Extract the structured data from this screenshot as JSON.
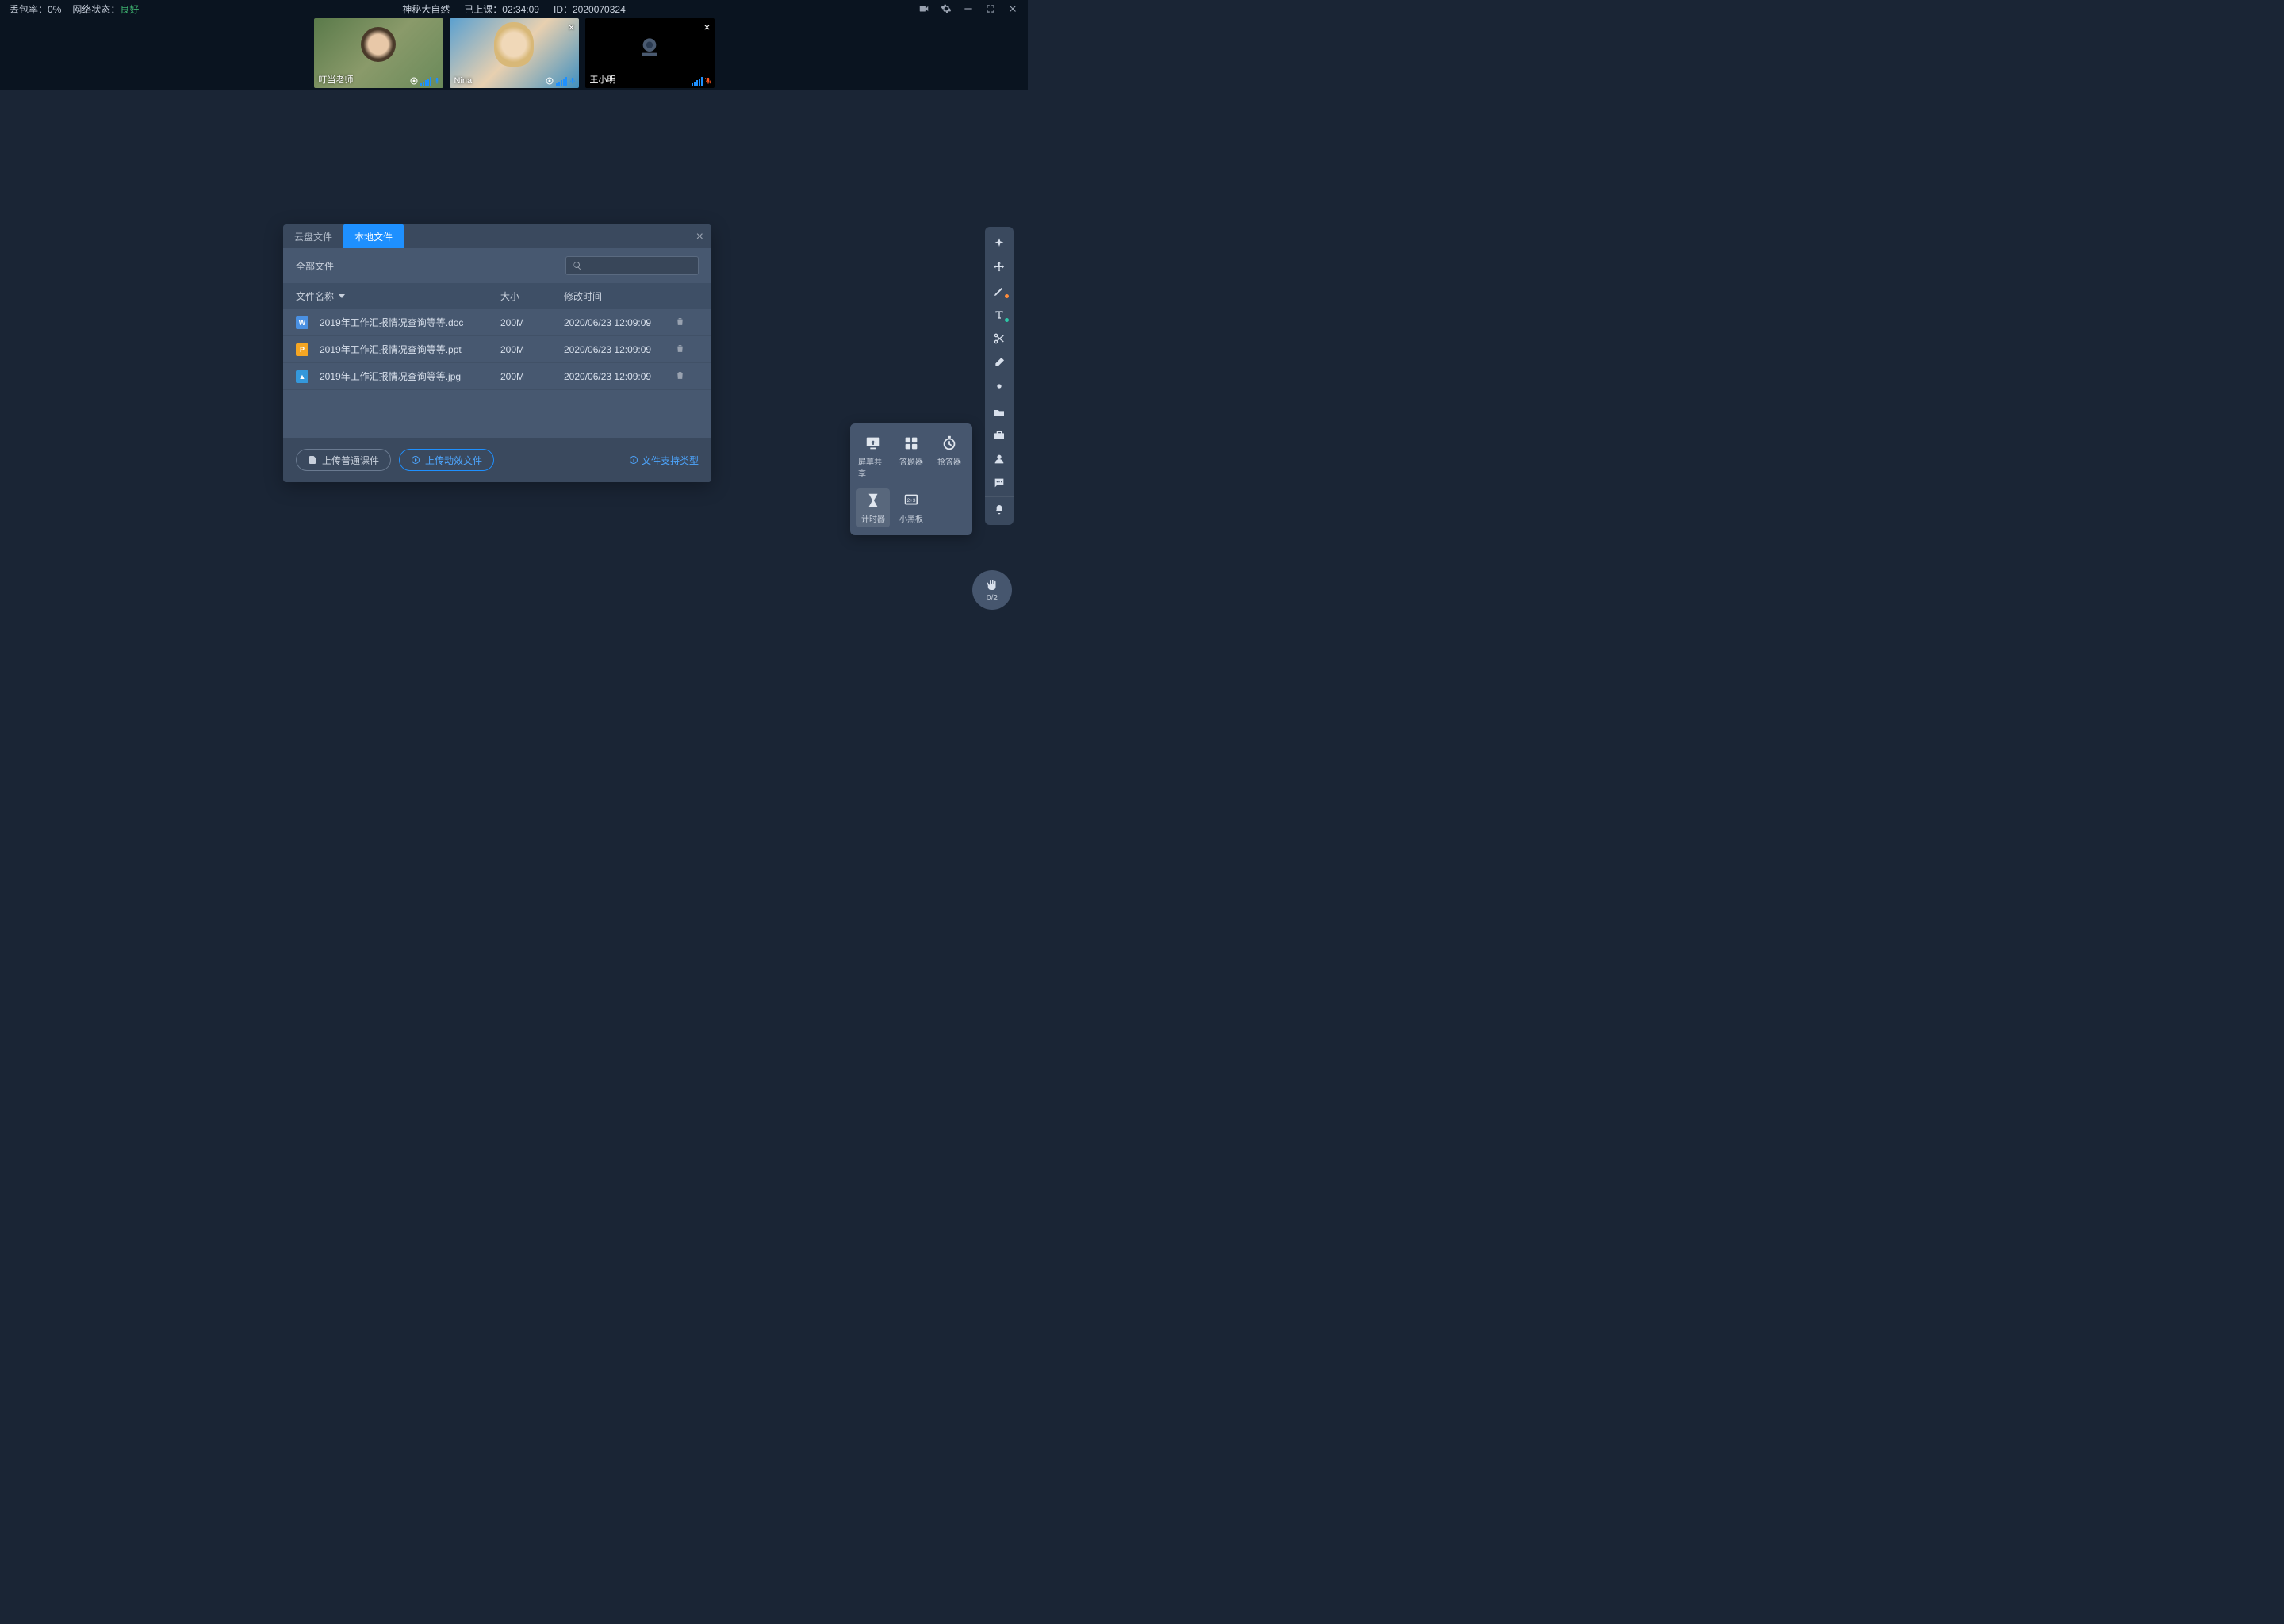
{
  "topbar": {
    "loss_label": "丢包率：",
    "loss_value": "0%",
    "net_label": "网络状态：",
    "net_value": "良好",
    "title": "神秘大自然",
    "elapsed_label": "已上课：",
    "elapsed_value": "02:34:09",
    "id_label": "ID：",
    "id_value": "2020070324"
  },
  "videos": [
    {
      "name": "叮当老师",
      "muted": false,
      "hasClose": false
    },
    {
      "name": "Nina",
      "muted": false,
      "hasClose": true
    },
    {
      "name": "王小明",
      "muted": true,
      "hasClose": true
    }
  ],
  "modal": {
    "tab_cloud": "云盘文件",
    "tab_local": "本地文件",
    "filter_all": "全部文件",
    "header_name": "文件名称",
    "header_size": "大小",
    "header_time": "修改时间",
    "files": [
      {
        "icon": "doc",
        "iconLetter": "W",
        "name": "2019年工作汇报情况查询等等.doc",
        "size": "200M",
        "time": "2020/06/23 12:09:09"
      },
      {
        "icon": "ppt",
        "iconLetter": "P",
        "name": "2019年工作汇报情况查询等等.ppt",
        "size": "200M",
        "time": "2020/06/23 12:09:09"
      },
      {
        "icon": "jpg",
        "iconLetter": "▲",
        "name": "2019年工作汇报情况查询等等.jpg",
        "size": "200M",
        "time": "2020/06/23 12:09:09"
      }
    ],
    "btn_upload_normal": "上传普通课件",
    "btn_upload_anim": "上传动效文件",
    "support_link": "文件支持类型"
  },
  "popover": {
    "screen_share": "屏幕共享",
    "answer": "答题器",
    "grab": "抢答器",
    "timer": "计时器",
    "blackboard": "小黑板"
  },
  "hand": {
    "count": "0/2"
  }
}
